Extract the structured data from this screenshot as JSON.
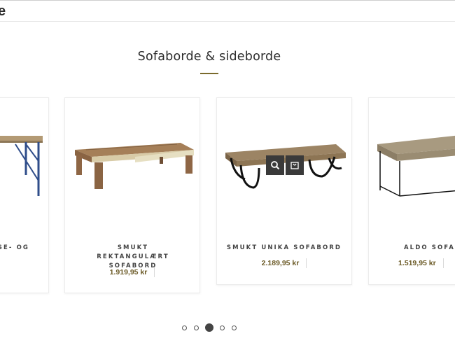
{
  "header": {
    "partial_text": "e"
  },
  "section": {
    "title": "Sofaborde & sideborde"
  },
  "products": [
    {
      "name": "SE- OG",
      "price": ""
    },
    {
      "name": "SMUKT REKTANGULÆRT SOFABORD",
      "price": "1.919,95 kr"
    },
    {
      "name": "SMUKT UNIKA SOFABORD",
      "price": "2.189,95 kr"
    },
    {
      "name": "ALDO SOFABO",
      "price": "1.519,95 kr"
    }
  ],
  "quick_actions": {
    "search_icon": "magnifier-icon",
    "cart_icon": "shopping-bag-icon"
  },
  "carousel": {
    "dot_count": 5,
    "active_index": 2
  },
  "colors": {
    "accent": "#7a6a2c",
    "price": "#6b5a26",
    "action_button": "#3a3a3a"
  }
}
